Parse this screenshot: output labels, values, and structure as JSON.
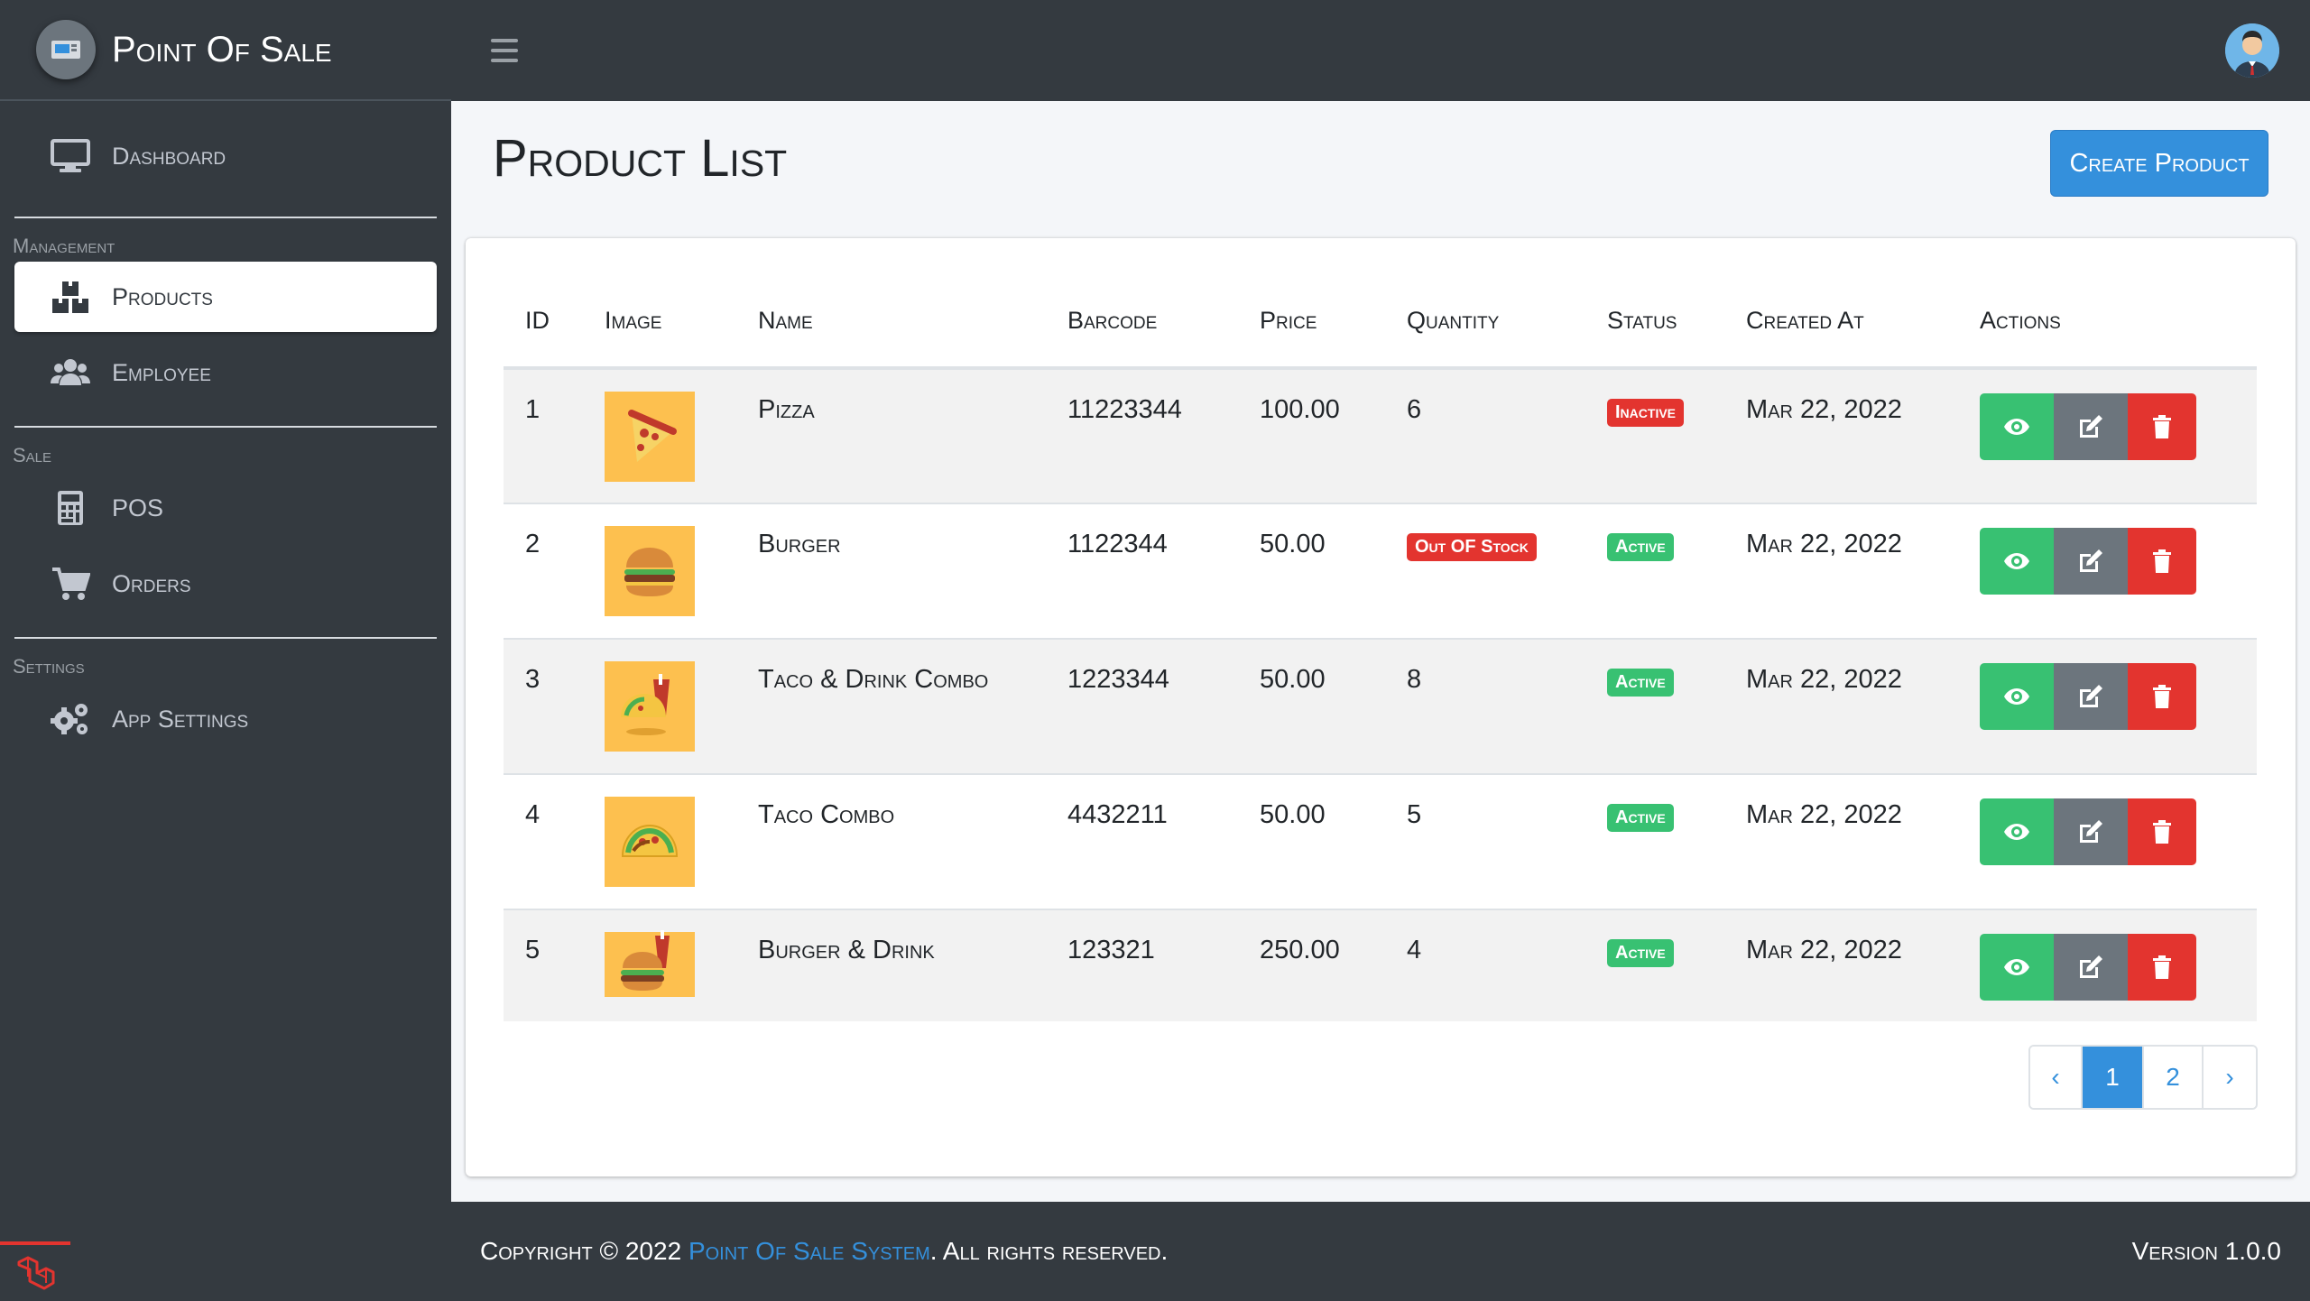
{
  "brand": {
    "title": "Point Of Sale"
  },
  "sidebar": {
    "dashboard": "Dashboard",
    "sections": [
      {
        "header": "Management",
        "items": [
          "Products",
          "Employee"
        ]
      },
      {
        "header": "Sale",
        "items": [
          "POS",
          "Orders"
        ]
      },
      {
        "header": "Settings",
        "items": [
          "App Settings"
        ]
      }
    ]
  },
  "page": {
    "title": "Product List",
    "create_label": "Create Product"
  },
  "table": {
    "headers": [
      "ID",
      "Image",
      "Name",
      "Barcode",
      "Price",
      "Quantity",
      "Status",
      "Created At",
      "Actions"
    ],
    "rows": [
      {
        "id": "1",
        "name": "Pizza",
        "barcode": "11223344",
        "price": "100.00",
        "quantity": "6",
        "quantity_badge": "",
        "status": "Inactive",
        "created": "Mar 22, 2022",
        "image": "pizza-icon"
      },
      {
        "id": "2",
        "name": "Burger",
        "barcode": "1122344",
        "price": "50.00",
        "quantity": "",
        "quantity_badge": "Out OF Stock",
        "status": "Active",
        "created": "Mar 22, 2022",
        "image": "burger-icon"
      },
      {
        "id": "3",
        "name": "Taco & Drink Combo",
        "barcode": "1223344",
        "price": "50.00",
        "quantity": "8",
        "quantity_badge": "",
        "status": "Active",
        "created": "Mar 22, 2022",
        "image": "taco-drink-icon"
      },
      {
        "id": "4",
        "name": "Taco Combo",
        "barcode": "4432211",
        "price": "50.00",
        "quantity": "5",
        "quantity_badge": "",
        "status": "Active",
        "created": "Mar 22, 2022",
        "image": "taco-icon"
      },
      {
        "id": "5",
        "name": "Burger & Drink",
        "barcode": "123321",
        "price": "250.00",
        "quantity": "4",
        "quantity_badge": "",
        "status": "Active",
        "created": "Mar 22, 2022",
        "image": "burger-drink-icon"
      }
    ]
  },
  "pagination": {
    "prev": "‹",
    "pages": [
      "1",
      "2"
    ],
    "next": "›",
    "current": "1"
  },
  "footer": {
    "copyright_prefix": "Copyright © 2022",
    "link": "Point Of Sale System",
    "suffix": ". All rights reserved.",
    "version": "Version 1.0.0"
  },
  "colors": {
    "primary": "#3490dc",
    "success": "#38c172",
    "danger": "#e3342f",
    "secondary": "#6c757d",
    "dark": "#343a40"
  }
}
